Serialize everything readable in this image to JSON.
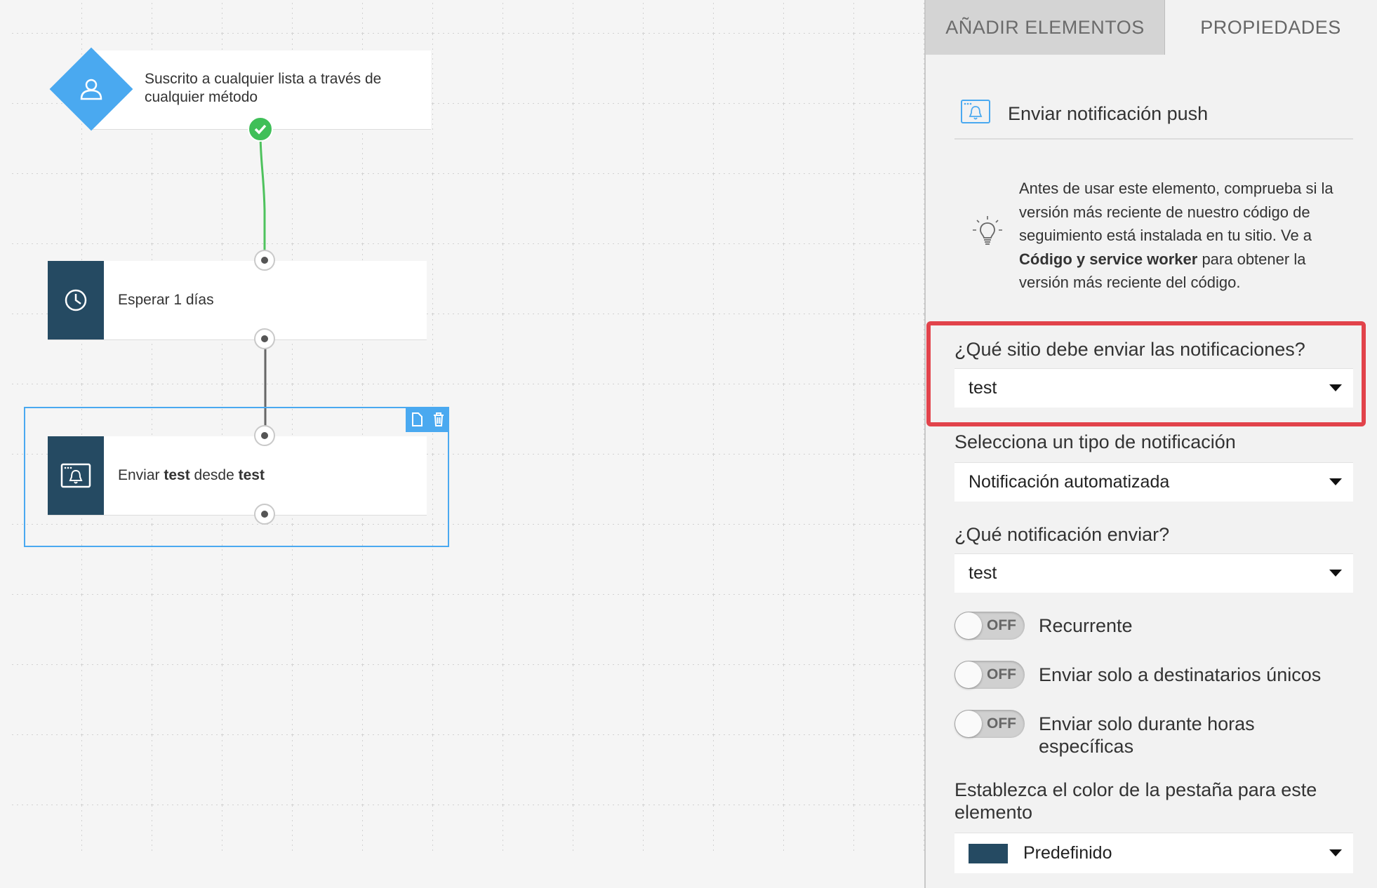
{
  "canvas": {
    "trigger": {
      "text": "Suscrito a cualquier lista a través de cualquier método",
      "icon": "user-icon"
    },
    "wait": {
      "text": "Esperar 1 días",
      "icon": "clock-icon"
    },
    "send": {
      "prefix": "Enviar ",
      "item": "test",
      "middle": " desde ",
      "site": "test",
      "icon": "push-notification-icon"
    },
    "selection_tools": {
      "copy_icon": "copy-icon",
      "delete_icon": "trash-icon"
    }
  },
  "panel": {
    "tabs": [
      {
        "label": "AÑADIR ELEMENTOS",
        "active": true
      },
      {
        "label": "PROPIEDADES",
        "active": false
      }
    ],
    "element_title": "Enviar notificación push",
    "tip": {
      "text_1": "Antes de usar este elemento, comprueba si la versión más reciente de nuestro código de seguimiento está instalada en tu sitio. Ve a ",
      "bold": "Código y service worker",
      "text_2": " para obtener la versión más reciente del código."
    },
    "site": {
      "label": "¿Qué sitio debe enviar las notificaciones?",
      "value": "test"
    },
    "notification_type": {
      "label": "Selecciona un tipo de notificación",
      "value": "Notificación automatizada"
    },
    "notification": {
      "label": "¿Qué notificación enviar?",
      "value": "test"
    },
    "toggles": [
      {
        "label": "Recurrente",
        "state": "OFF"
      },
      {
        "label": "Enviar solo a destinatarios únicos",
        "state": "OFF"
      },
      {
        "label": "Enviar solo durante horas específicas",
        "state": "OFF"
      }
    ],
    "tab_color": {
      "label": "Establezca el color de la pestaña para este elemento",
      "value": "Predefinido",
      "swatch": "#254a62"
    }
  },
  "colors": {
    "accent": "#4aa9f0",
    "node_dark": "#254a62",
    "highlight": "#e2434b",
    "success": "#3fbf58"
  }
}
